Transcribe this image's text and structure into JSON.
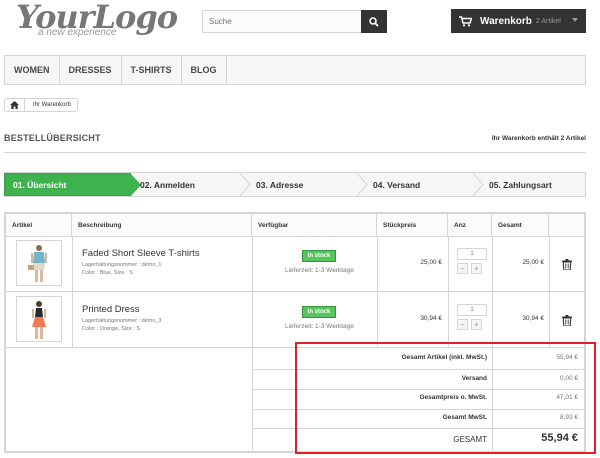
{
  "header": {
    "logo_text": "YourLogo",
    "logo_tagline": "a new experience",
    "search_placeholder": "Suche",
    "cart_label": "Warenkorb",
    "cart_count": "2 Artikel"
  },
  "nav": [
    "WOMEN",
    "DRESSES",
    "T-SHIRTS",
    "BLOG"
  ],
  "breadcrumb": {
    "current": "Ihr Warenkorb"
  },
  "page": {
    "title": "BESTELLÜBERSICHT",
    "cart_note": "Ihr Warenkorb enthält 2 Artikel"
  },
  "steps": [
    "01. Übersicht",
    "02. Anmelden",
    "03. Adresse",
    "04. Versand",
    "05. Zahlungsart"
  ],
  "table": {
    "headers": [
      "Artikel",
      "Beschreibung",
      "Verfügbar",
      "Stückpreis",
      "Anz",
      "Gesamt"
    ],
    "rows": [
      {
        "name": "Faded Short Sleeve T-shirts",
        "sku": "Lagerhaltungsnummer : demo_1",
        "attrs": "Color : Blue, Size : S",
        "stock": "In stock",
        "delivery": "Lieferzeit: 1-3 Werktage",
        "unit_price": "25,00 €",
        "qty": "1",
        "total": "25,00 €"
      },
      {
        "name": "Printed Dress",
        "sku": "Lagerhaltungsnummer : demo_3",
        "attrs": "Color : Orange, Size : S",
        "stock": "In stock",
        "delivery": "Lieferzeit: 1-3 Werktage",
        "unit_price": "30,94 €",
        "qty": "1",
        "total": "30,94 €"
      }
    ],
    "totals": [
      {
        "label": "Gesamt Artikel (inkl. MwSt.)",
        "value": "55,94 €"
      },
      {
        "label": "Versand",
        "value": "0,00 €"
      },
      {
        "label": "Gesamtpreis o. MwSt.",
        "value": "47,01 €"
      },
      {
        "label": "Gesamt MwSt.",
        "value": "8,93 €"
      }
    ],
    "grand_total": {
      "label": "GESAMT",
      "value": "55,94 €"
    }
  },
  "colors": {
    "accent_green": "#3eb34d",
    "highlight_red": "#e31e24",
    "dark": "#333333"
  }
}
